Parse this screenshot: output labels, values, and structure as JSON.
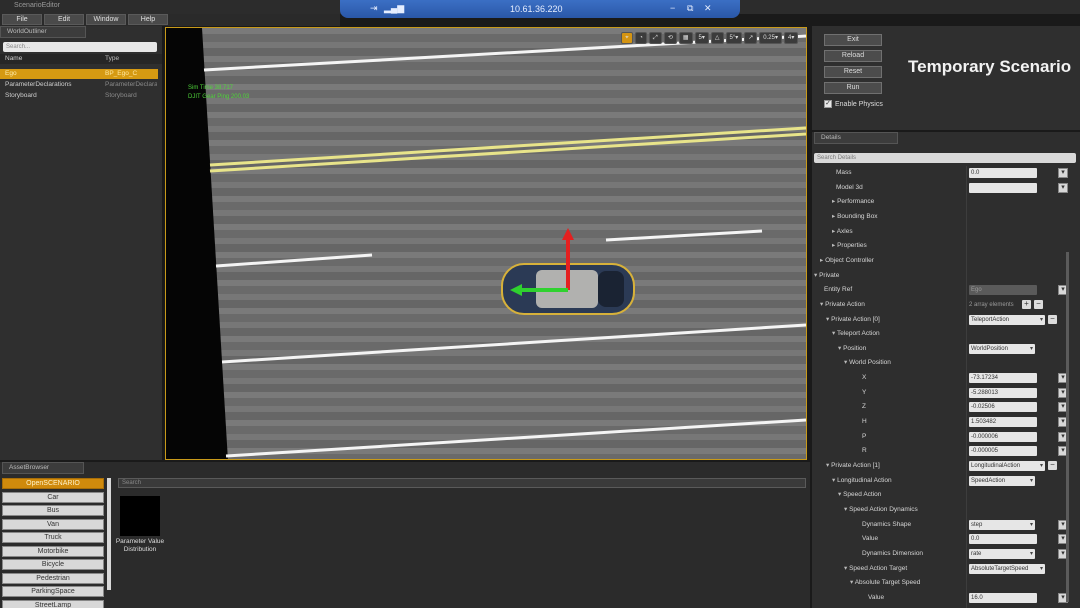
{
  "window": {
    "title": "ScenarioEditor",
    "remote_ip": "10.61.36.220"
  },
  "menu": [
    "File",
    "Edit",
    "Window",
    "Help"
  ],
  "outliner": {
    "tab": "WorldOutliner",
    "search_placeholder": "Search...",
    "columns": [
      "Name",
      "Type"
    ],
    "rows": [
      {
        "name": "Ego",
        "type": "BP_Ego_C",
        "selected": true
      },
      {
        "name": "ParameterDeclarations",
        "type": "ParameterDeclarations"
      },
      {
        "name": "Storyboard",
        "type": "Storyboard"
      }
    ]
  },
  "viewport": {
    "stats_line1": "Sim Time 38.717",
    "stats_line2": "DJIT Gear Ping 200.03",
    "toolbar": [
      "⌖",
      "◔",
      "⤢",
      "⟲",
      "▦",
      "5▾",
      "△",
      "5°▾",
      "↗",
      "0.25▾",
      "4▾"
    ]
  },
  "controls": {
    "buttons": [
      "Exit",
      "Reload",
      "Reset",
      "Run"
    ],
    "enable_physics": "Enable Physics",
    "enable_physics_checked": true,
    "scenario_title": "Temporary Scenario"
  },
  "details": {
    "tab": "Details",
    "search_placeholder": "Search Details",
    "rows": [
      {
        "label": "Mass",
        "value": "0.0",
        "indent": 24
      },
      {
        "label": "Model 3d",
        "value": "",
        "indent": 24
      },
      {
        "label": "Performance",
        "indent": 20,
        "expand": "▸"
      },
      {
        "label": "Bounding Box",
        "indent": 20,
        "expand": "▸"
      },
      {
        "label": "Axles",
        "indent": 20,
        "expand": "▸"
      },
      {
        "label": "Properties",
        "indent": 20,
        "expand": "▸"
      },
      {
        "label": "Object Controller",
        "indent": 8,
        "expand": "▸"
      },
      {
        "label": "Private",
        "indent": 2,
        "expand": "▾"
      },
      {
        "label": "Entity Ref",
        "value": "Ego",
        "indent": 12,
        "disabled": true
      },
      {
        "label": "Private Action",
        "value": "2 array elements",
        "indent": 8,
        "expand": "▾",
        "plain": true
      },
      {
        "label": "Private Action [0]",
        "value": "TeleportAction",
        "indent": 14,
        "expand": "▾",
        "dropdown": true
      },
      {
        "label": "Teleport Action",
        "indent": 20,
        "expand": "▾"
      },
      {
        "label": "Position",
        "value": "WorldPosition",
        "indent": 26,
        "expand": "▾",
        "dropdown": true
      },
      {
        "label": "World Position",
        "indent": 32,
        "expand": "▾"
      },
      {
        "label": "X",
        "value": "-73.17234",
        "indent": 50
      },
      {
        "label": "Y",
        "value": "-5.288013",
        "indent": 50
      },
      {
        "label": "Z",
        "value": "-0.02506",
        "indent": 50
      },
      {
        "label": "H",
        "value": "1.503482",
        "indent": 50
      },
      {
        "label": "P",
        "value": "-0.000006",
        "indent": 50
      },
      {
        "label": "R",
        "value": "-0.000005",
        "indent": 50
      },
      {
        "label": "Private Action [1]",
        "value": "LongitudinalAction",
        "indent": 14,
        "expand": "▾",
        "dropdown": true
      },
      {
        "label": "Longitudinal Action",
        "value": "SpeedAction",
        "indent": 20,
        "expand": "▾",
        "dropdown": true
      },
      {
        "label": "Speed Action",
        "indent": 26,
        "expand": "▾"
      },
      {
        "label": "Speed Action Dynamics",
        "indent": 32,
        "expand": "▾"
      },
      {
        "label": "Dynamics Shape",
        "value": "step",
        "indent": 50,
        "dropdown": true
      },
      {
        "label": "Value",
        "value": "0.0",
        "indent": 50
      },
      {
        "label": "Dynamics Dimension",
        "value": "rate",
        "indent": 50,
        "dropdown": true
      },
      {
        "label": "Speed Action Target",
        "value": "AbsoluteTargetSpeed",
        "indent": 32,
        "expand": "▾",
        "dropdown": true
      },
      {
        "label": "Absolute Target Speed",
        "indent": 38,
        "expand": "▾"
      },
      {
        "label": "Value",
        "value": "16.0",
        "indent": 56
      }
    ]
  },
  "asset_browser": {
    "tab": "AssetBrowser",
    "search_placeholder": "Search",
    "categories": [
      "OpenSCENARIO",
      "Car",
      "Bus",
      "Van",
      "Truck",
      "Motorbike",
      "Bicycle",
      "Pedestrian",
      "ParkingSpace",
      "StreetLamp"
    ],
    "asset_label": "Parameter Value Distribution"
  }
}
